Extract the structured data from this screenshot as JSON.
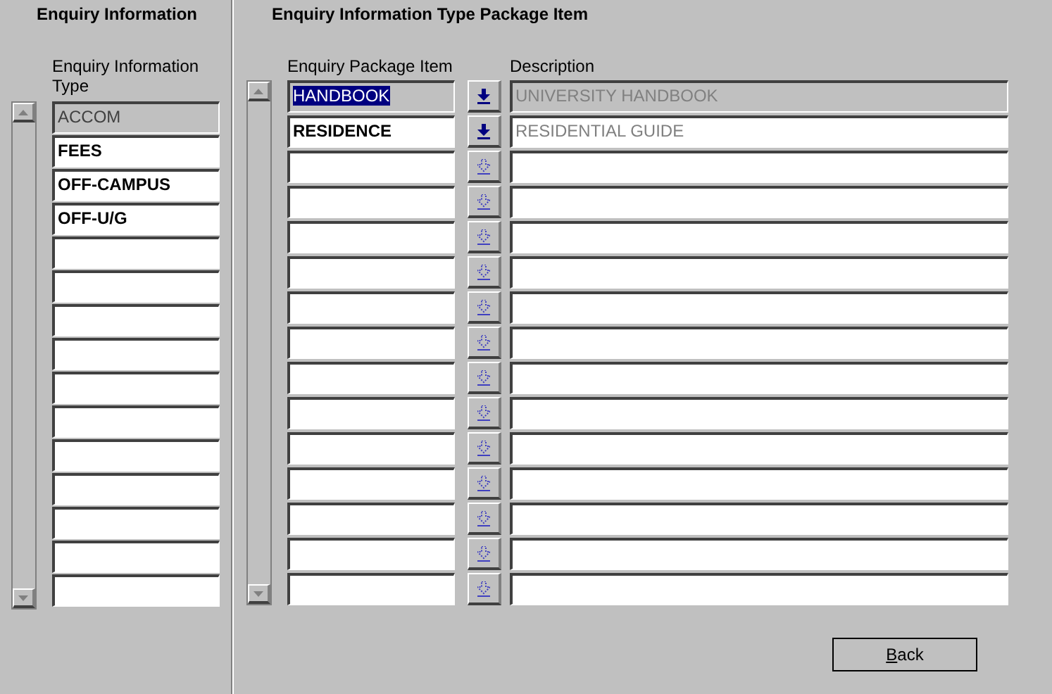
{
  "left_panel": {
    "title": "Enquiry Information",
    "column_header": "Enquiry Information Type",
    "rows": [
      {
        "value": "ACCOM",
        "current": true
      },
      {
        "value": "FEES",
        "current": false
      },
      {
        "value": "OFF-CAMPUS",
        "current": false
      },
      {
        "value": "OFF-U/G",
        "current": false
      },
      {
        "current": false
      },
      {
        "current": false
      },
      {
        "current": false
      },
      {
        "current": false
      },
      {
        "current": false
      },
      {
        "current": false
      },
      {
        "current": false
      },
      {
        "current": false
      },
      {
        "current": false
      },
      {
        "current": false
      },
      {
        "current": false
      }
    ]
  },
  "right_panel": {
    "title": "Enquiry Information Type Package Item",
    "columns": [
      "Enquiry Package Item",
      "Description"
    ],
    "rows": [
      {
        "item": "HANDBOOK",
        "description": "UNIVERSITY HANDBOOK",
        "current": true,
        "selected": true,
        "lookup_enabled": true
      },
      {
        "item": "RESIDENCE",
        "description": "RESIDENTIAL GUIDE",
        "current": false,
        "selected": false,
        "lookup_enabled": true
      },
      {
        "current": false,
        "selected": false,
        "lookup_enabled": false
      },
      {
        "current": false,
        "selected": false,
        "lookup_enabled": false
      },
      {
        "current": false,
        "selected": false,
        "lookup_enabled": false
      },
      {
        "current": false,
        "selected": false,
        "lookup_enabled": false
      },
      {
        "current": false,
        "selected": false,
        "lookup_enabled": false
      },
      {
        "current": false,
        "selected": false,
        "lookup_enabled": false
      },
      {
        "current": false,
        "selected": false,
        "lookup_enabled": false
      },
      {
        "current": false,
        "selected": false,
        "lookup_enabled": false
      },
      {
        "current": false,
        "selected": false,
        "lookup_enabled": false
      },
      {
        "current": false,
        "selected": false,
        "lookup_enabled": false
      },
      {
        "current": false,
        "selected": false,
        "lookup_enabled": false
      },
      {
        "current": false,
        "selected": false,
        "lookup_enabled": false
      },
      {
        "current": false,
        "selected": false,
        "lookup_enabled": false
      }
    ]
  },
  "back_button": {
    "label": "Back"
  }
}
